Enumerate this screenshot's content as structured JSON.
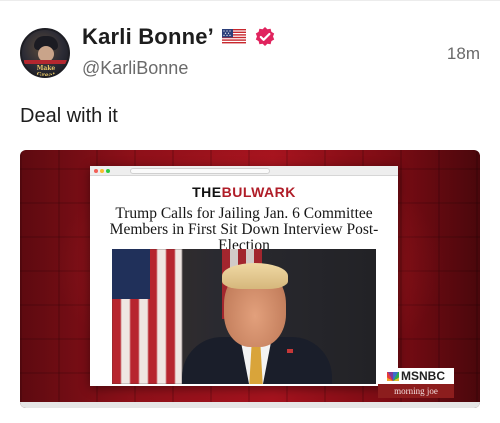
{
  "post": {
    "author_name": "Karli Bonne’",
    "handle": "@KarliBonne",
    "timestamp": "18m",
    "text": "Deal with it",
    "badges": [
      "us-flag-icon",
      "verified-icon"
    ],
    "avatar_caption": "Make Great"
  },
  "media": {
    "site_logo_the": "THE",
    "site_logo_bulwark": "BULWARK",
    "headline": "Trump Calls for Jailing Jan. 6 Committee Members in First Sit Down Interview Post-Election",
    "network": "MSNBC",
    "show": "morning joe"
  },
  "colors": {
    "verified": "#e0245e",
    "background_red": "#a5131e",
    "bulwark_red": "#b01d28"
  }
}
